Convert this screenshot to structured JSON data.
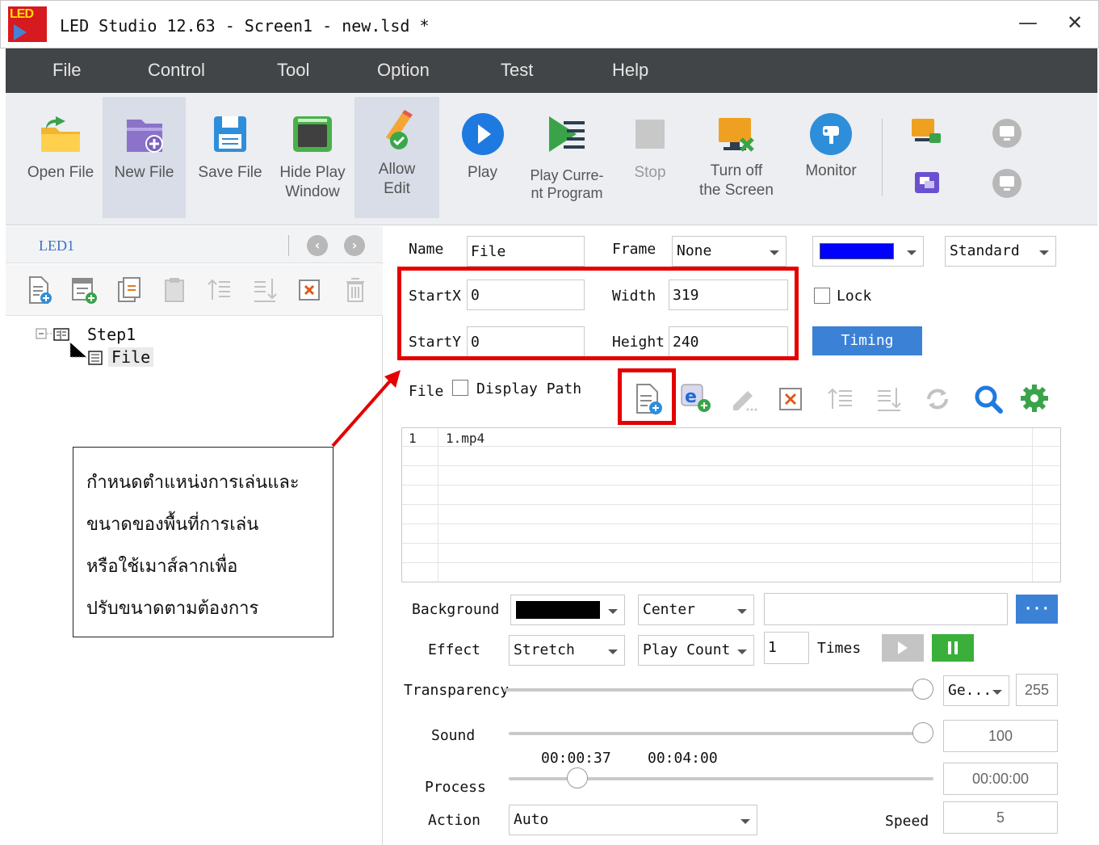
{
  "window": {
    "logo_text": "LED",
    "title": "LED Studio 12.63 - Screen1 - new.lsd *",
    "minimize": "—",
    "close": "✕"
  },
  "menu": [
    "File",
    "Control",
    "Tool",
    "Option",
    "Test",
    "Help"
  ],
  "toolbar": {
    "open_file": "Open File",
    "new_file": "New File",
    "save_file": "Save File",
    "hide_play_window": [
      "Hide Play",
      "Window"
    ],
    "allow_edit": [
      "Allow",
      "Edit"
    ],
    "play": "Play",
    "play_current_program": [
      "Play Curre-",
      "nt Program"
    ],
    "stop": "Stop",
    "turn_off_screen": [
      "Turn off",
      "the Screen"
    ],
    "monitor": "Monitor"
  },
  "left": {
    "tab": "LED1",
    "nav_prev": "‹",
    "nav_next": "›",
    "tree": {
      "step": "Step1",
      "file": "File"
    },
    "annotation": [
      "กำหนดตำแหน่งการเล่นและ",
      "ขนาดของพื้นที่การเล่น",
      "หรือใช้เมาส์ลากเพื่อ",
      "ปรับขนาดตามต้องการ"
    ]
  },
  "props": {
    "name_label": "Name",
    "name_value": "File",
    "frame_label": "Frame",
    "frame_value": "None",
    "color_value": "#0000ff",
    "mode_value": "Standard",
    "startx_label": "StartX",
    "startx_value": "0",
    "width_label": "Width",
    "width_value": "319",
    "starty_label": "StartY",
    "starty_value": "0",
    "height_label": "Height",
    "height_value": "240",
    "lock_label": "Lock",
    "timing_label": "Timing",
    "file_label": "File",
    "display_path_label": "Display Path"
  },
  "files": [
    {
      "index": "1",
      "name": "1.mp4"
    }
  ],
  "bottom": {
    "background_label": "Background",
    "background_color": "#000000",
    "background_align": "Center",
    "browse_label": "···",
    "effect_label": "Effect",
    "effect_value": "Stretch",
    "play_mode": "Play Count",
    "count_value": "1",
    "times_label": "Times",
    "transparency_label": "Transparency",
    "transparency_mode": "Ge...",
    "transparency_value": "255",
    "sound_label": "Sound",
    "sound_value": "100",
    "time_current": "00:00:37",
    "time_total": "00:04:00",
    "process_label": "Process",
    "process_value": "00:00:00",
    "action_label": "Action",
    "action_value": "Auto",
    "speed_label": "Speed",
    "speed_value": "5"
  }
}
